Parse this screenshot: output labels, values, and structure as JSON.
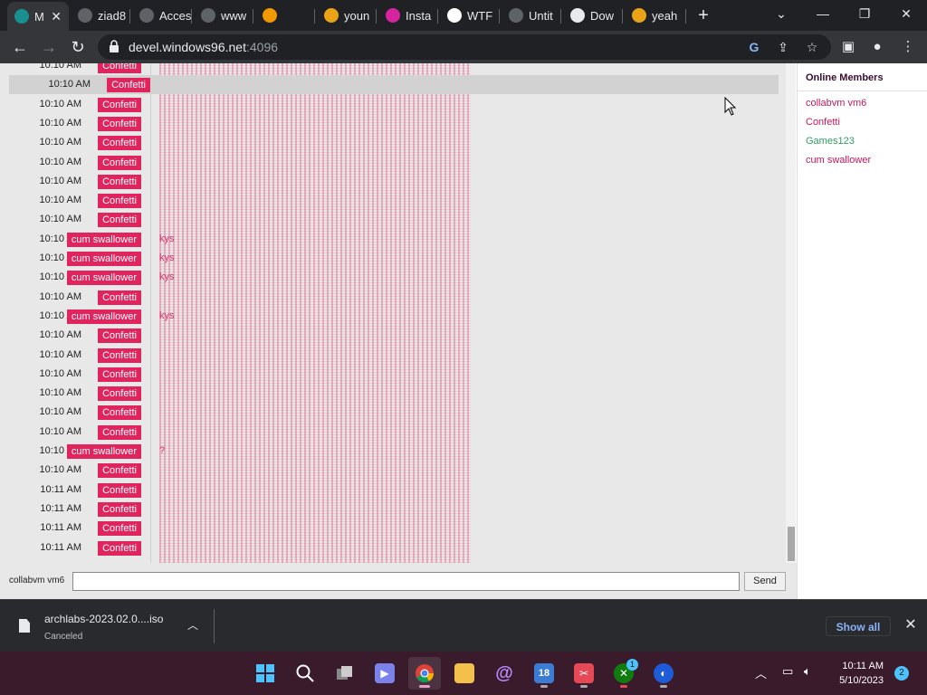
{
  "browser": {
    "tabs": [
      {
        "label": "M",
        "icon": "page-favicon-icon",
        "color": "#1a8f8f"
      },
      {
        "label": "ziad8",
        "icon": "globe-icon",
        "color": "#5f6368"
      },
      {
        "label": "Acces",
        "icon": "globe-icon",
        "color": "#5f6368"
      },
      {
        "label": "www",
        "icon": "globe-icon",
        "color": "#5f6368"
      },
      {
        "label": "",
        "icon": "home-icon",
        "color": "#f29900"
      },
      {
        "label": "youn",
        "icon": "bracket-logo-icon",
        "color": "#e8a317"
      },
      {
        "label": "Insta",
        "icon": "instagram-icon",
        "color": "#d6249f"
      },
      {
        "label": "WTF",
        "icon": "wtf-icon",
        "color": "#ffffff"
      },
      {
        "label": "Untit",
        "icon": "globe-icon",
        "color": "#5f6368"
      },
      {
        "label": "Dow",
        "icon": "download-icon",
        "color": "#e8eaed"
      },
      {
        "label": "yeah",
        "icon": "mascot-icon",
        "color": "#e8a317"
      }
    ],
    "url_host": "devel.windows96.net",
    "url_port": ":4096"
  },
  "chat": {
    "messages": [
      {
        "time": "10:10 AM",
        "user": "Confetti",
        "text": ""
      },
      {
        "time": "10:10 AM",
        "user": "Confetti",
        "text": ""
      },
      {
        "time": "10:10 AM",
        "user": "Confetti",
        "text": ""
      },
      {
        "time": "10:10 AM",
        "user": "Confetti",
        "text": ""
      },
      {
        "time": "10:10 AM",
        "user": "Confetti",
        "text": ""
      },
      {
        "time": "10:10 AM",
        "user": "Confetti",
        "text": ""
      },
      {
        "time": "10:10 AM",
        "user": "Confetti",
        "text": ""
      },
      {
        "time": "10:10 AM",
        "user": "Confetti",
        "text": ""
      },
      {
        "time": "10:10 AM",
        "user": "Confetti",
        "text": ""
      },
      {
        "time": "10:10 AM",
        "user": "cum swallower",
        "text": "kys"
      },
      {
        "time": "10:10 AM",
        "user": "cum swallower",
        "text": "kys"
      },
      {
        "time": "10:10 AM",
        "user": "cum swallower",
        "text": "kys"
      },
      {
        "time": "10:10 AM",
        "user": "Confetti",
        "text": ""
      },
      {
        "time": "10:10 AM",
        "user": "cum swallower",
        "text": "kys"
      },
      {
        "time": "10:10 AM",
        "user": "Confetti",
        "text": ""
      },
      {
        "time": "10:10 AM",
        "user": "Confetti",
        "text": ""
      },
      {
        "time": "10:10 AM",
        "user": "Confetti",
        "text": ""
      },
      {
        "time": "10:10 AM",
        "user": "Confetti",
        "text": ""
      },
      {
        "time": "10:10 AM",
        "user": "Confetti",
        "text": ""
      },
      {
        "time": "10:10 AM",
        "user": "Confetti",
        "text": ""
      },
      {
        "time": "10:10 AM",
        "user": "cum swallower",
        "text": "?"
      },
      {
        "time": "10:10 AM",
        "user": "Confetti",
        "text": ""
      },
      {
        "time": "10:11 AM",
        "user": "Confetti",
        "text": ""
      },
      {
        "time": "10:11 AM",
        "user": "Confetti",
        "text": ""
      },
      {
        "time": "10:11 AM",
        "user": "Confetti",
        "text": ""
      },
      {
        "time": "10:11 AM",
        "user": "Confetti",
        "text": ""
      }
    ],
    "input_label": "collabvm vm6",
    "input_value": "",
    "send_label": "Send"
  },
  "members": {
    "title": "Online Members",
    "list": [
      {
        "name": "collabvm vm6",
        "color": "#c2185b"
      },
      {
        "name": "Confetti",
        "color": "#c2185b"
      },
      {
        "name": "Games123",
        "color": "#2e9e5e"
      },
      {
        "name": "cum swallower",
        "color": "#c2185b"
      }
    ]
  },
  "download": {
    "filename": "archlabs-2023.02.0....iso",
    "status": "Canceled",
    "show_all": "Show all"
  },
  "taskbar": {
    "xbox_badge": "1",
    "calendar_day": "18",
    "time": "10:11 AM",
    "date": "5/10/2023",
    "notifications": "2"
  }
}
